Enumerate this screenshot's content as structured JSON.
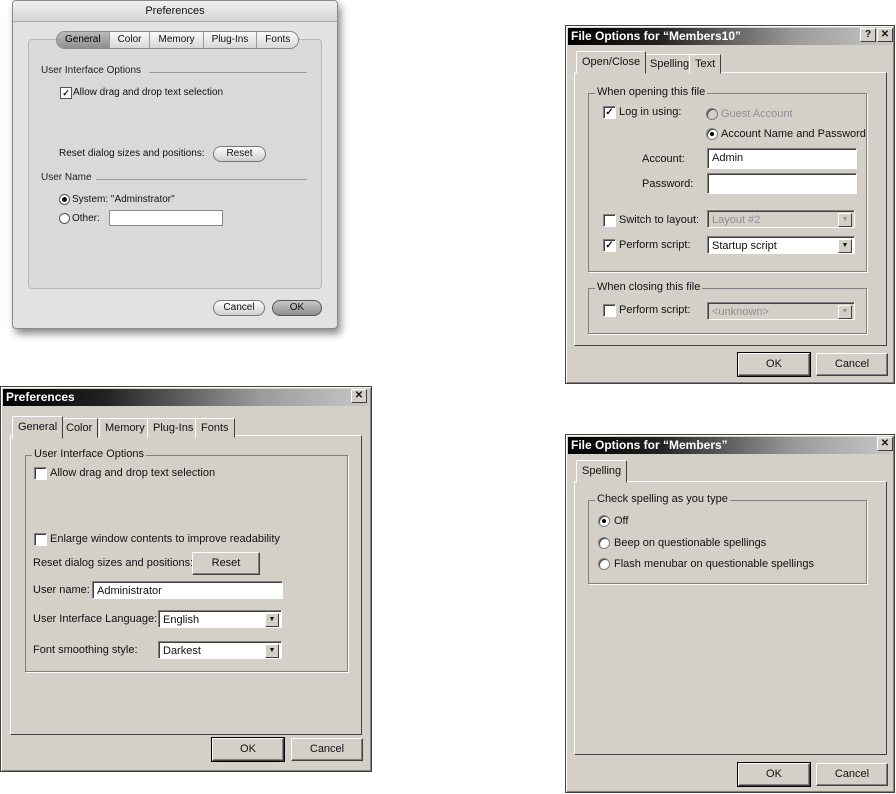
{
  "mac": {
    "title": "Preferences",
    "tabs": [
      "General",
      "Color",
      "Memory",
      "Plug-Ins",
      "Fonts"
    ],
    "ui_options_label": "User Interface Options",
    "drag_drop_label": "Allow drag and drop text selection",
    "reset_label": "Reset dialog sizes and positions:",
    "reset_button": "Reset",
    "user_name_label": "User Name",
    "system_label": "System: \"Adminstrator\"",
    "other_label": "Other:",
    "other_value": "",
    "cancel": "Cancel",
    "ok": "OK"
  },
  "win_prefs": {
    "title": "Preferences",
    "close_glyph": "✕",
    "tabs": [
      "General",
      "Color",
      "Memory",
      "Plug-Ins",
      "Fonts"
    ],
    "ui_options_label": "User Interface Options",
    "drag_drop_label": "Allow drag and drop text selection",
    "enlarge_label": "Enlarge window contents to improve readability",
    "reset_label": "Reset dialog sizes and positions:",
    "reset_button": "Reset",
    "user_name_label": "User name:",
    "user_name_value": "Administrator",
    "language_label": "User Interface Language:",
    "language_value": "English",
    "smoothing_label": "Font smoothing style:",
    "smoothing_value": "Darkest",
    "ok": "OK",
    "cancel": "Cancel"
  },
  "win_file10": {
    "title": "File Options for “Members10”",
    "help_glyph": "?",
    "close_glyph": "✕",
    "tabs": [
      "Open/Close",
      "Spelling",
      "Text"
    ],
    "opening_label": "When opening this file",
    "login_label": "Log in using:",
    "guest_label": "Guest Account",
    "account_pw_label": "Account Name and Password",
    "account_label": "Account:",
    "account_value": "Admin",
    "password_label": "Password:",
    "password_value": "",
    "switch_layout_label": "Switch to layout:",
    "layout_value": "Layout #2",
    "perform_script_label": "Perform script:",
    "script_value": "Startup script",
    "closing_label": "When closing this file",
    "close_script_label": "Perform script:",
    "close_script_value": "<unknown>",
    "ok": "OK",
    "cancel": "Cancel"
  },
  "win_file": {
    "title": "File Options for “Members”",
    "close_glyph": "✕",
    "tabs": [
      "Spelling"
    ],
    "check_label": "Check spelling as you type",
    "off_label": "Off",
    "beep_label": "Beep on questionable spellings",
    "flash_label": "Flash menubar on questionable spellings",
    "ok": "OK",
    "cancel": "Cancel"
  }
}
